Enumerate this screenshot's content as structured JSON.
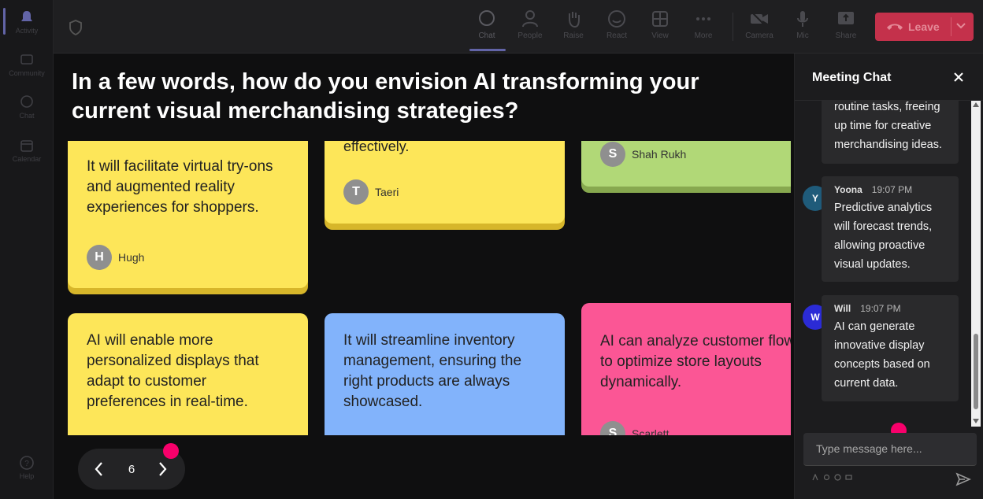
{
  "rail": {
    "items": [
      {
        "label": "Activity",
        "icon": "bell-icon"
      },
      {
        "label": "Community",
        "icon": "community-icon"
      },
      {
        "label": "Chat",
        "icon": "chat-icon"
      },
      {
        "label": "Calendar",
        "icon": "calendar-icon"
      },
      {
        "label": "Help",
        "icon": "help-icon"
      }
    ]
  },
  "toolbar": {
    "chat": "Chat",
    "people": "People",
    "raise": "Raise",
    "react": "React",
    "view": "View",
    "more": "More",
    "camera": "Camera",
    "mic": "Mic",
    "share": "Share",
    "leave": "Leave",
    "active_tab": "Chat"
  },
  "question": "In a few words, how do you envision AI transforming your current visual merchandising strategies?",
  "cards": [
    {
      "text": "It will facilitate virtual try-ons and augmented reality experiences for shoppers.",
      "initial": "H",
      "author": "Hugh",
      "color": "#fde659"
    },
    {
      "text": "effectively.",
      "initial": "T",
      "author": "Taeri",
      "color": "#fde659"
    },
    {
      "text": "",
      "initial": "S",
      "author": "Shah Rukh",
      "color": "#b1d877"
    },
    {
      "text": "AI will enable more personalized displays that adapt to customer preferences in real-time.",
      "color": "#fde659"
    },
    {
      "text": "It will streamline inventory management, ensuring the right products are always showcased.",
      "color": "#82b3fb"
    },
    {
      "text": "AI can analyze customer flow to optimize store layouts dynamically.",
      "initial": "S",
      "author": "Scarlett",
      "color": "#fb5695"
    }
  ],
  "pager": {
    "page": "6"
  },
  "chat": {
    "title": "Meeting Chat",
    "messages": [
      {
        "sender": "",
        "time": "",
        "text": "routine tasks, freeing up time for creative merchandising ideas."
      },
      {
        "sender": "Yoona",
        "initial": "Y",
        "time": "19:07 PM",
        "text": "Predictive analytics will forecast trends, allowing proactive visual updates.",
        "avatar_color": "#1f5b7a"
      },
      {
        "sender": "Will",
        "initial": "W",
        "time": "19:07 PM",
        "text": "AI can generate innovative display concepts based on current data.",
        "avatar_color": "#2b2bd6"
      }
    ],
    "compose_placeholder": "Type message here..."
  },
  "colors": {
    "accent": "#6264a7",
    "leave": "#c4314b",
    "notification": "#f8006b"
  }
}
